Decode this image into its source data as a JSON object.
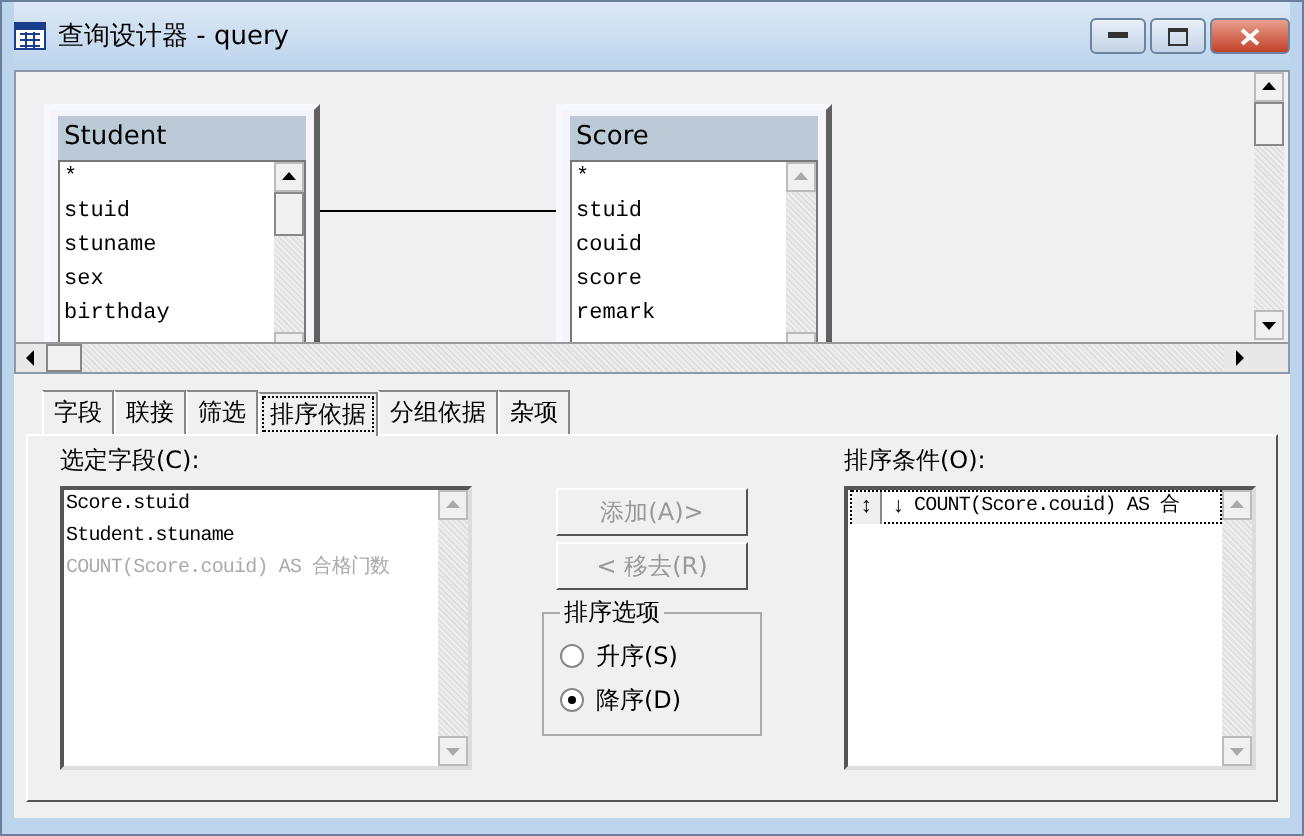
{
  "window": {
    "title": "查询设计器 - query"
  },
  "tables": [
    {
      "name": "Student",
      "active": true,
      "fields": [
        "*",
        "stuid",
        "stuname",
        "sex",
        "birthday"
      ]
    },
    {
      "name": "Score",
      "active": false,
      "fields": [
        "*",
        "stuid",
        "couid",
        "score",
        "remark"
      ]
    }
  ],
  "tabs": [
    {
      "label": "字段",
      "selected": false
    },
    {
      "label": "联接",
      "selected": false
    },
    {
      "label": "筛选",
      "selected": false
    },
    {
      "label": "排序依据",
      "selected": true
    },
    {
      "label": "分组依据",
      "selected": false
    },
    {
      "label": "杂项",
      "selected": false
    }
  ],
  "selected_fields": {
    "label": "选定字段(C):",
    "items": [
      {
        "text": "Score.stuid",
        "disabled": false
      },
      {
        "text": "Student.stuname",
        "disabled": false
      },
      {
        "text": "COUNT(Score.couid) AS 合格门数",
        "disabled": true
      }
    ]
  },
  "buttons": [
    {
      "label": "添加(A)>",
      "disabled": true
    },
    {
      "label": "< 移去(R)",
      "disabled": true
    }
  ],
  "sort_options": {
    "title": "排序选项",
    "options": [
      {
        "label": "升序(S)",
        "selected": false
      },
      {
        "label": "降序(D)",
        "selected": true
      }
    ]
  },
  "sort_conditions": {
    "label": "排序条件(O):",
    "items": [
      {
        "handle": "↕",
        "arrow": "↓",
        "text": "COUNT(Score.couid) AS 合"
      }
    ]
  }
}
